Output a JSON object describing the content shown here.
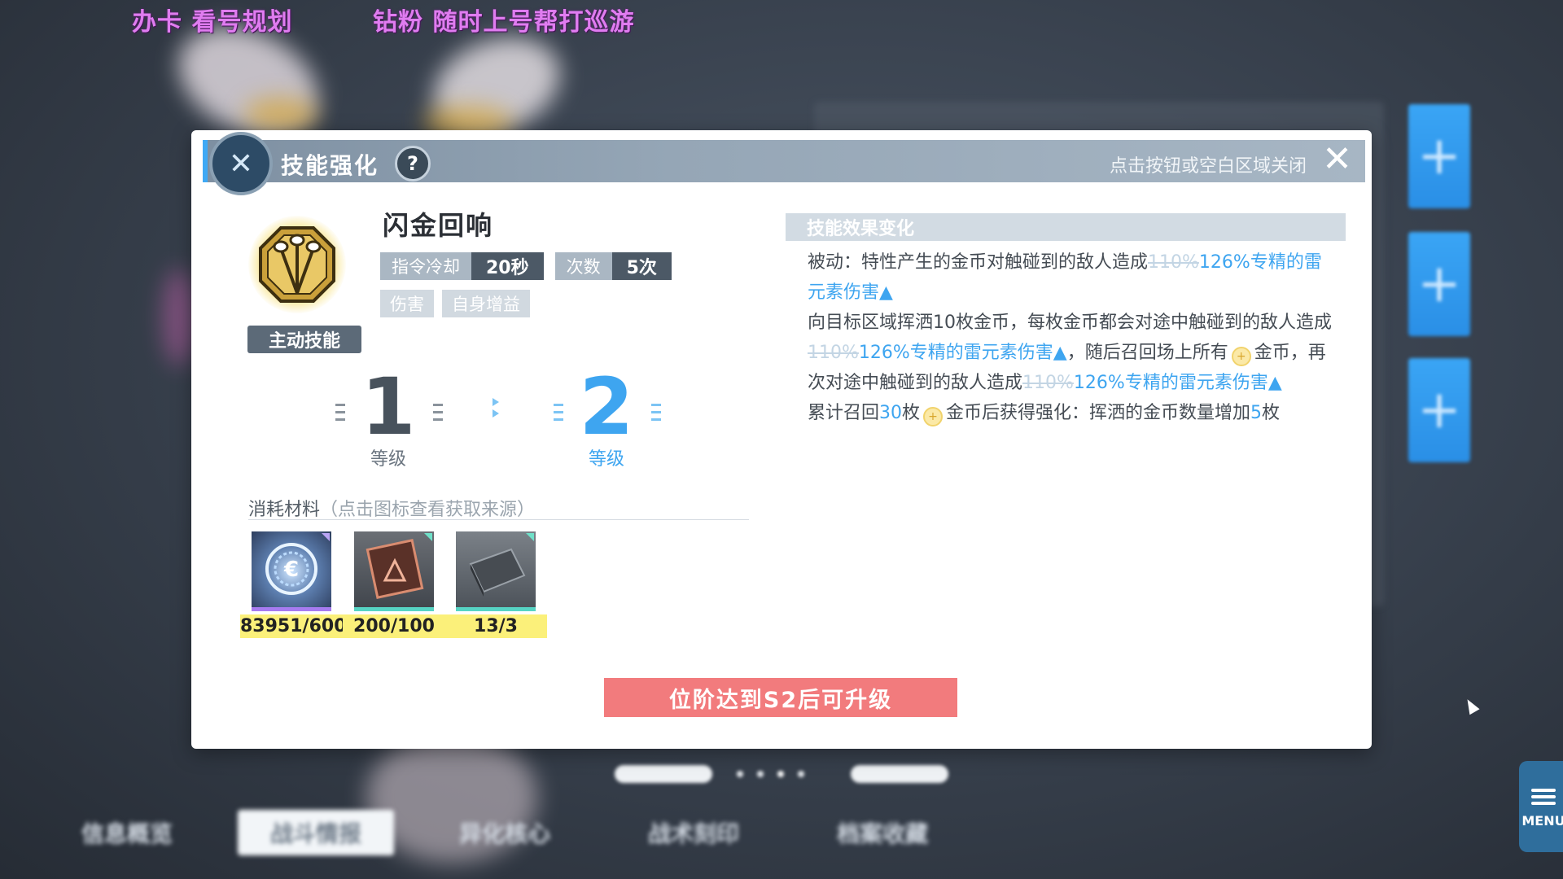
{
  "overlay": {
    "left_text": "办卡 看号规划",
    "right_text": "钻粉 随时上号帮打巡游"
  },
  "dialog": {
    "title": "技能强化",
    "help_icon": "question-icon",
    "close_hint": "点击按钮或空白区域关闭",
    "close_icon": "close-icon"
  },
  "skill": {
    "name": "闪金回响",
    "cooldown_label": "指令冷却",
    "cooldown_value": "20秒",
    "uses_label": "次数",
    "uses_value": "5次",
    "tags": [
      "伤害",
      "自身增益"
    ],
    "type_badge": "主动技能"
  },
  "levels": {
    "from": "1",
    "to": "2",
    "label": "等级"
  },
  "materials": {
    "title": "消耗材料",
    "hint": "（点击图标查看获取来源）",
    "items": [
      {
        "name": "crystal-emblem-material",
        "qty": "83951/600"
      },
      {
        "name": "delta-tile-material",
        "qty": "200/100"
      },
      {
        "name": "steel-plate-material",
        "qty": "13/3"
      }
    ]
  },
  "upgrade_button": "位阶达到S2后可升级",
  "effects": {
    "heading": "技能效果变化",
    "p1_a": "被动：特性产生的金币对触碰到的敌人造成",
    "p1_strike": "110%",
    "p1_hl": "126%专精的雷元素伤害▲",
    "p2_a": "向目标区域挥洒10枚金币，每枚金币都会对途中触碰到的敌人造成",
    "p2_strike": "110%",
    "p2_hl": "126%专精的雷元素伤害▲",
    "p2_b": "，随后召回场上所有",
    "p2_c": "金币，再次对途中触碰到的敌人造成",
    "p2_strike2": "110%",
    "p2_hl2": "126%专精的雷元素伤害▲",
    "p3_a": "累计召回",
    "p3_num": "30",
    "p3_b": "枚",
    "p3_c": "金币后获得强化：挥洒的金币数量增加",
    "p3_num2": "5",
    "p3_d": "枚"
  },
  "bottom": {
    "tabs": [
      "信息概览",
      "战斗情报",
      "异化核心",
      "战术刻印",
      "档案收藏"
    ],
    "active_index": 1,
    "menu_label": "MENU"
  },
  "colors": {
    "accent_blue": "#3ea5f0",
    "upgrade_red": "#f27b7d",
    "qty_yellow": "#fbf07a"
  }
}
